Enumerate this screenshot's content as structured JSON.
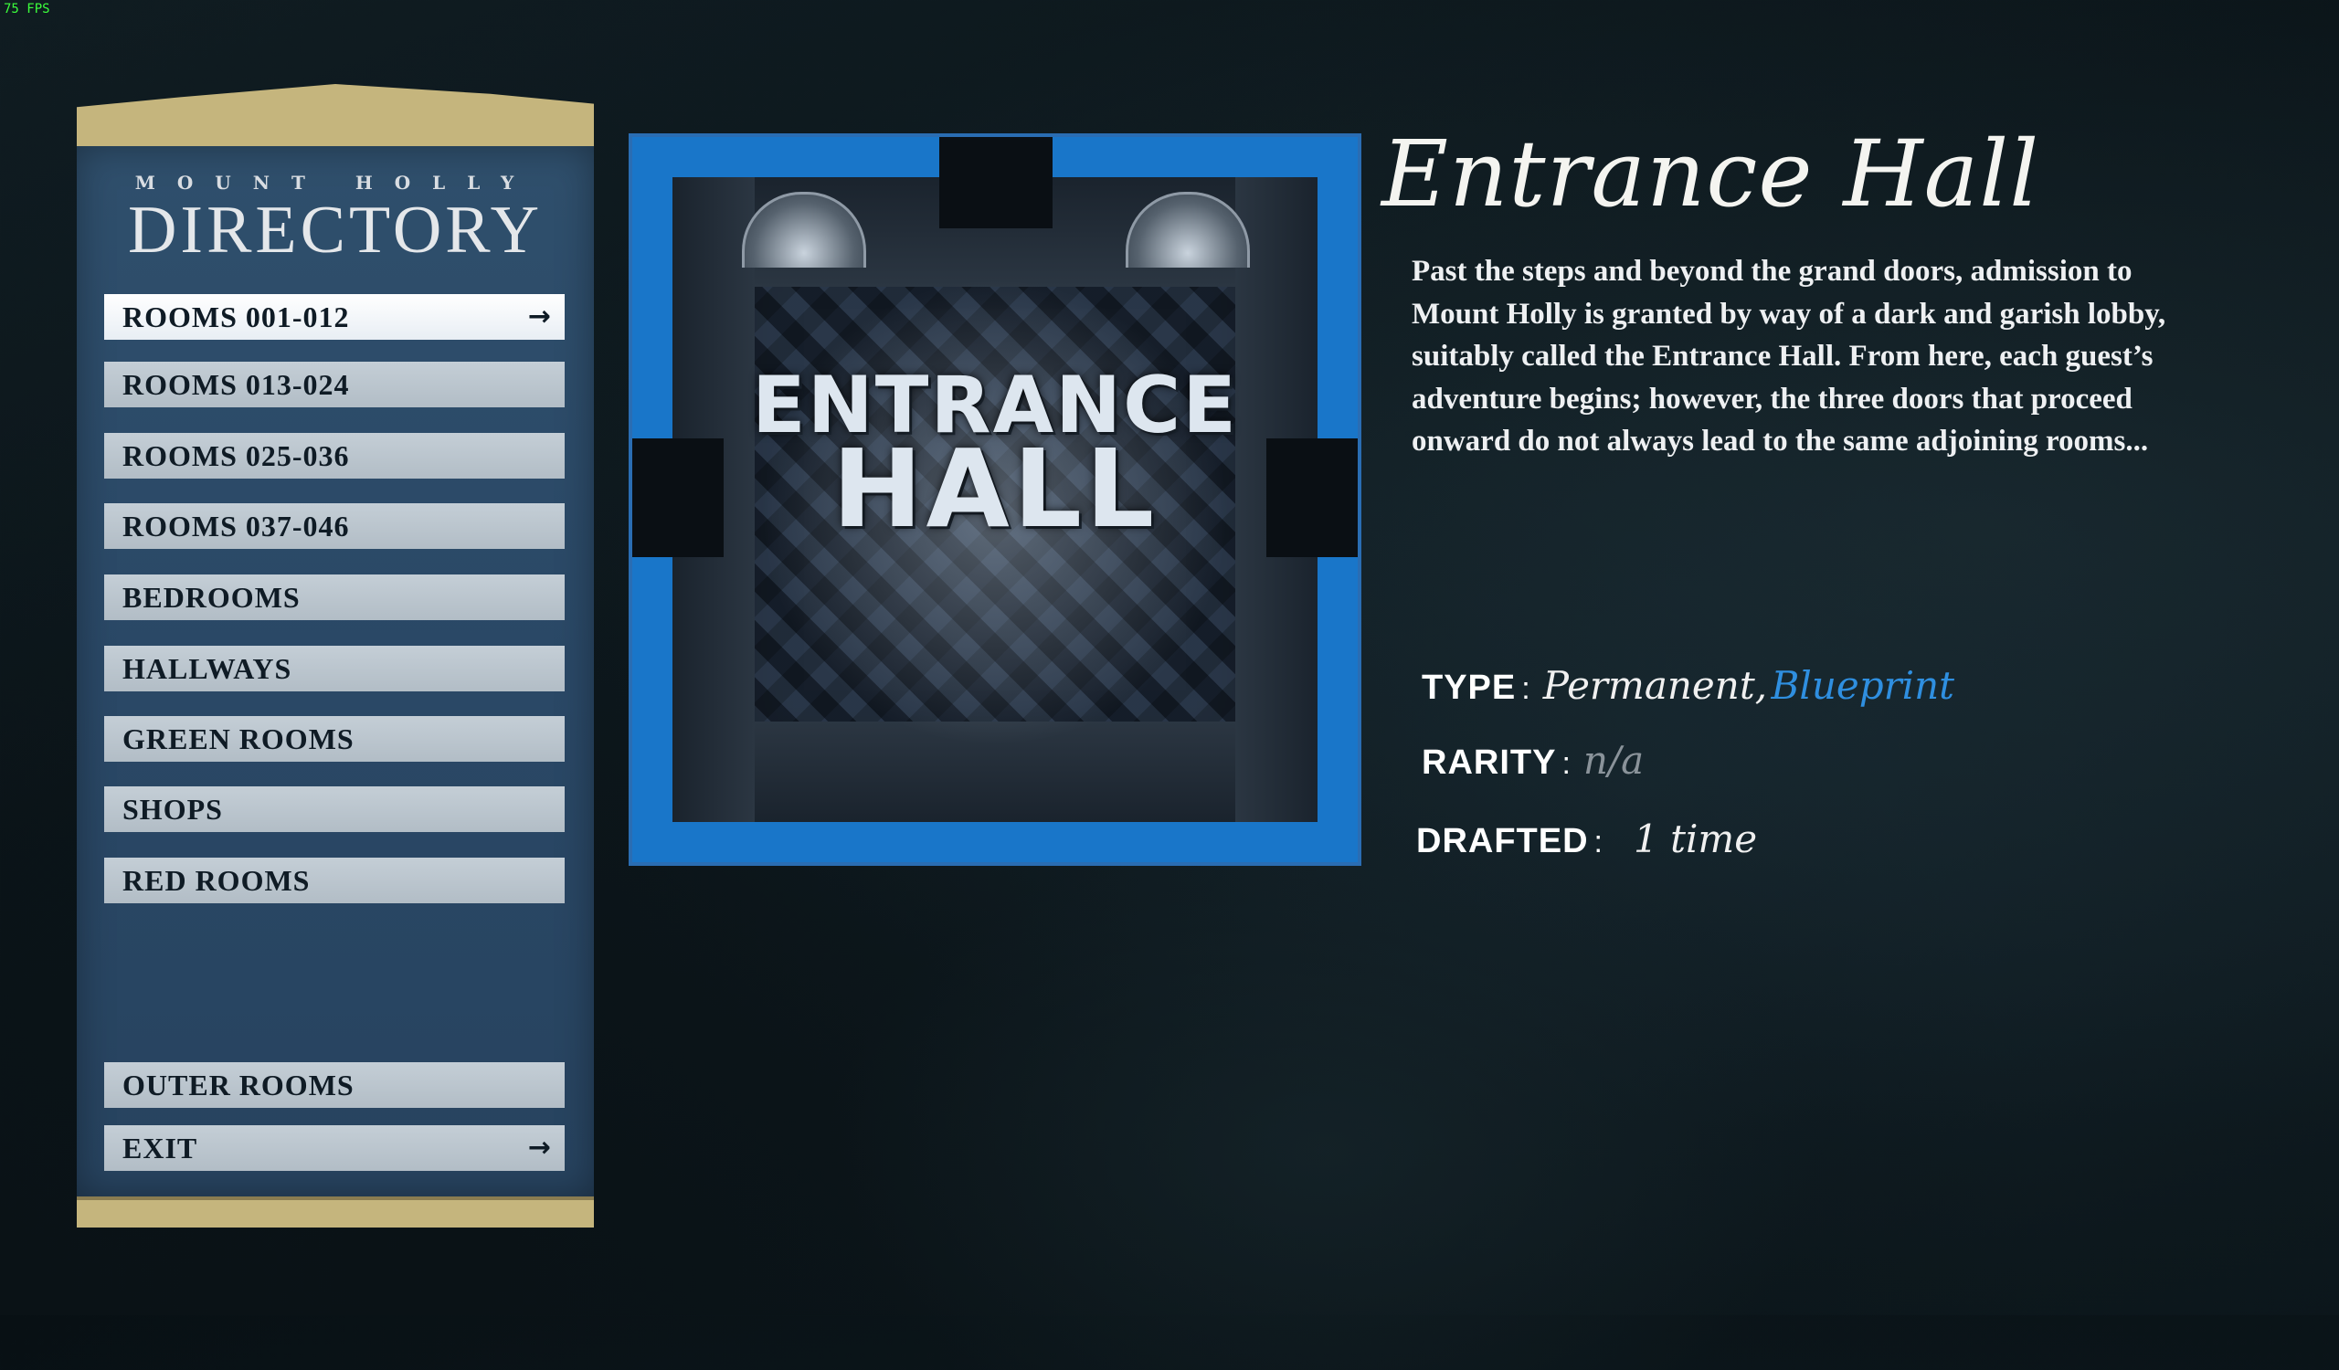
{
  "overlay": {
    "fps": "75 FPS"
  },
  "directory": {
    "subtitle": "MOUNT HOLLY",
    "title": "DIRECTORY",
    "items": [
      {
        "label": "ROOMS 001-012",
        "active": true,
        "arrow": "→"
      },
      {
        "label": "ROOMS 013-024"
      },
      {
        "label": "ROOMS 025-036"
      },
      {
        "label": "ROOMS 037-046"
      },
      {
        "label": "BEDROOMS"
      },
      {
        "label": "HALLWAYS"
      },
      {
        "label": "GREEN ROOMS"
      },
      {
        "label": "SHOPS"
      },
      {
        "label": "RED ROOMS"
      },
      {
        "label": "OUTER ROOMS"
      },
      {
        "label": "EXIT",
        "arrow": "→"
      }
    ]
  },
  "room": {
    "image_label_line1": "ENTRANCE",
    "image_label_line2": "HALL",
    "title": "Entrance Hall",
    "description": "Past the steps and beyond the grand doors, admission to Mount Holly is granted by way of a dark and garish lobby, suitably called the Entrance Hall. From here, each guest’s adventure begins; however, the three doors that proceed onward do not always lead to the same adjoining rooms...",
    "stats": {
      "type_label": "TYPE",
      "type_value_1": "Permanent,",
      "type_value_2": "Blueprint",
      "rarity_label": "RARITY",
      "rarity_value": "n/a",
      "drafted_label": "DRAFTED",
      "drafted_value": "1 time",
      "colon": ":"
    }
  },
  "colors": {
    "panel_blue": "#2f4f6c",
    "panel_gold": "#c5b57d",
    "frame_blue": "#1976c9",
    "blueprint_blue": "#2f8fe0"
  }
}
